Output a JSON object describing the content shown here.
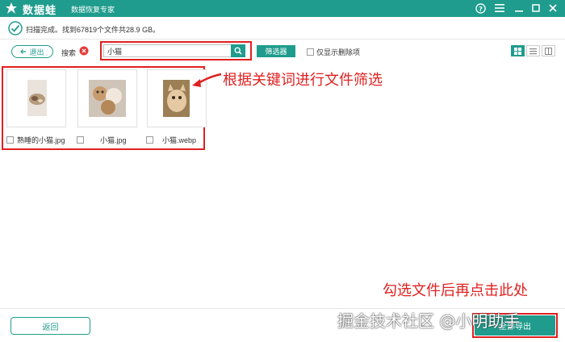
{
  "app": {
    "name": "数据蛙",
    "subtitle": "数据恢复专家"
  },
  "status": {
    "text": "扫描完成。找到67819个文件共28.9 GB。"
  },
  "toolbar": {
    "exit_label": "退出",
    "search_label": "搜索",
    "search_value": "小猫",
    "filter_label": "筛选器",
    "only_deleted_label": "仅显示删除项"
  },
  "files": [
    {
      "name": "熟睡的小猫.jpg",
      "checked": false
    },
    {
      "name": "小猫.jpg",
      "checked": false
    },
    {
      "name": "小猫.webp",
      "checked": false
    }
  ],
  "annotations": {
    "filter_hint": "根据关键词进行文件筛选",
    "select_hint": "勾选文件后再点击此处"
  },
  "footer": {
    "back_label": "返回",
    "recover_label": "全部导出"
  },
  "watermark": "掘金技术社区 @小明助手",
  "colors": {
    "accent": "#1f9c8d",
    "annotation": "#e02020"
  }
}
